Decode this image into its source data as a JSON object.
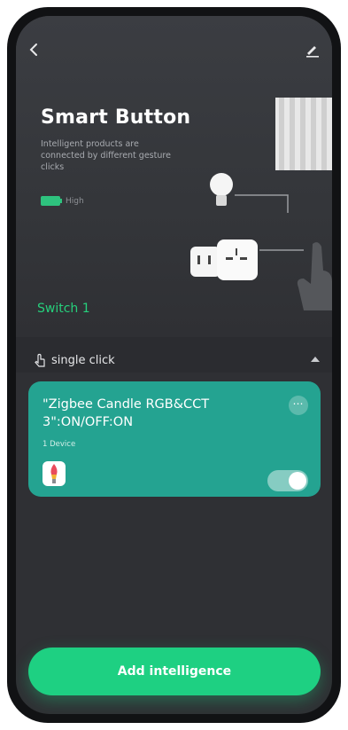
{
  "header": {
    "title": "Smart Button",
    "description": "Intelligent products are connected by different gesture clicks",
    "battery_label": "High"
  },
  "tabs": {
    "active": "Switch 1"
  },
  "section": {
    "gesture_label": "single click"
  },
  "action_card": {
    "title": "\"Zigbee Candle RGB&CCT 3\":ON/OFF:ON",
    "device_count": "1 Device",
    "more_glyph": "⋯",
    "enabled": true
  },
  "footer": {
    "add_label": "Add intelligence"
  },
  "colors": {
    "accent": "#1ed082",
    "card": "#24a391",
    "background": "#2f3034"
  },
  "icons": {
    "back": "chevron-left-icon",
    "edit": "edit-icon",
    "battery": "battery-icon",
    "hand": "hand-tap-icon",
    "collapse": "chevron-up-icon",
    "more": "more-icon",
    "device": "candle-bulb-icon"
  }
}
